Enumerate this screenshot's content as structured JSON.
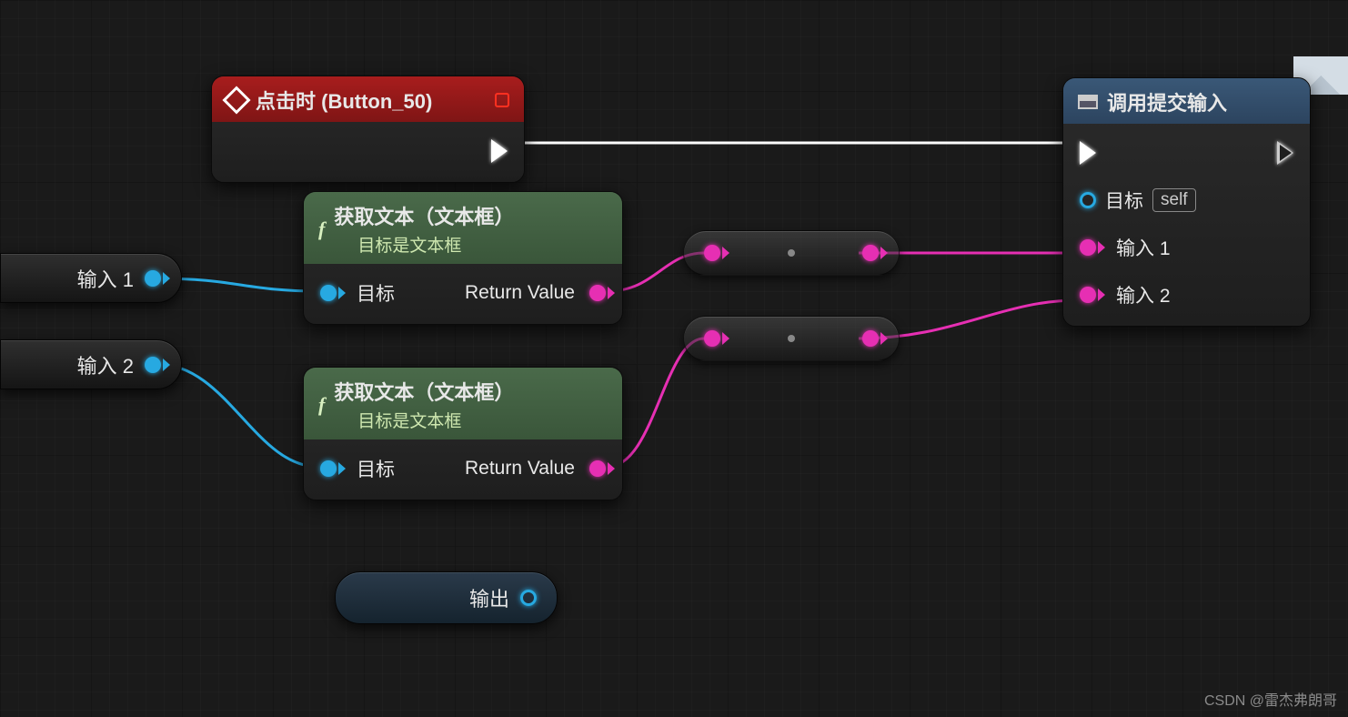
{
  "event_node": {
    "title": "点击时 (Button_50)"
  },
  "get_text_1": {
    "title": "获取文本（文本框）",
    "subtitle": "目标是文本框",
    "target_label": "目标",
    "return_label": "Return Value"
  },
  "get_text_2": {
    "title": "获取文本（文本框）",
    "subtitle": "目标是文本框",
    "target_label": "目标",
    "return_label": "Return Value"
  },
  "submit_node": {
    "title": "调用提交输入",
    "target_label": "目标",
    "target_value": "self",
    "input1_label": "输入 1",
    "input2_label": "输入 2"
  },
  "var_input1": {
    "label": "输入 1"
  },
  "var_input2": {
    "label": "输入 2"
  },
  "var_output": {
    "label": "输出"
  },
  "watermark": "CSDN @雷杰弗朗哥"
}
